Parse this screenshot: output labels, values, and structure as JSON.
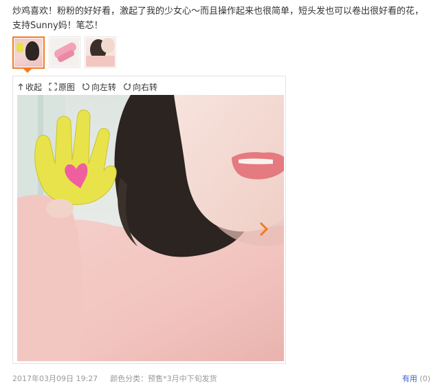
{
  "review": {
    "text": "炒鸡喜欢！粉粉的好好看，激起了我的少女心～而且操作起来也很简单，短头发也可以卷出很好看的花，支持Sunny妈！笔芯！"
  },
  "thumbnails": [
    {
      "label": "",
      "selected": true
    },
    {
      "label": "",
      "selected": false
    },
    {
      "label": "",
      "selected": false
    }
  ],
  "viewer": {
    "toolbar": {
      "collapse": "收起",
      "original": "原图",
      "rotate_left": "向左转",
      "rotate_right": "向右转"
    },
    "next_icon": "chevron-right-icon"
  },
  "meta": {
    "date": "2017年03月09日 19:27",
    "variant": "颜色分类：预售*3月中下旬发货"
  },
  "useful": {
    "label": "有用",
    "count": "(0)"
  },
  "colors": {
    "accent": "#f47a20",
    "link": "#3366cc",
    "muted": "#999999"
  }
}
